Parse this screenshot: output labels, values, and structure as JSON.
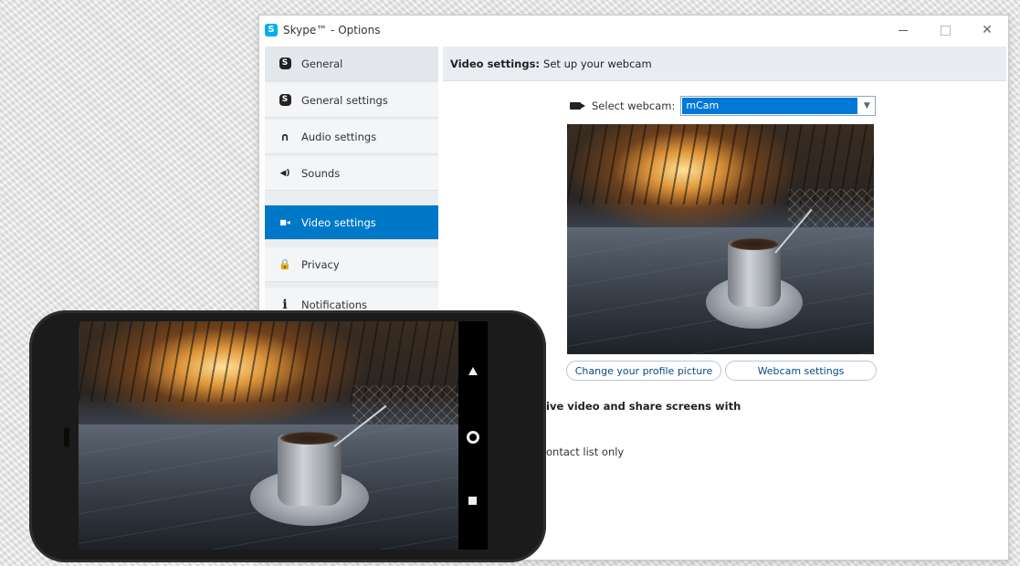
{
  "window": {
    "title": "Skype™ - Options",
    "logo_letter": "S"
  },
  "sidebar": {
    "items": [
      {
        "label": "General",
        "icon": "skype-icon",
        "glyph": "S"
      },
      {
        "label": "General settings",
        "icon": "skype-icon",
        "glyph": "S"
      },
      {
        "label": "Audio settings",
        "icon": "headset-icon",
        "glyph": "∩"
      },
      {
        "label": "Sounds",
        "icon": "speaker-icon",
        "glyph": "◀)"
      },
      {
        "label": "Video settings",
        "icon": "video-camera-icon",
        "glyph": "■◂"
      },
      {
        "label": "Privacy",
        "icon": "lock-icon",
        "glyph": "🔒"
      },
      {
        "label": "Notifications",
        "icon": "info-icon",
        "glyph": "i"
      }
    ]
  },
  "main": {
    "header_bold": "Video settings:",
    "header_text": "Set up your webcam",
    "select_label": "Select webcam:",
    "select_value": "mCam",
    "select_arrow": "▼",
    "change_picture_button": "Change your profile picture",
    "webcam_settings_button": "Webcam settings",
    "section_title": "ive video and share screens with",
    "contact_option": "ontact list only"
  },
  "colors": {
    "accent": "#0078c8",
    "select_highlight": "#0078d7"
  }
}
